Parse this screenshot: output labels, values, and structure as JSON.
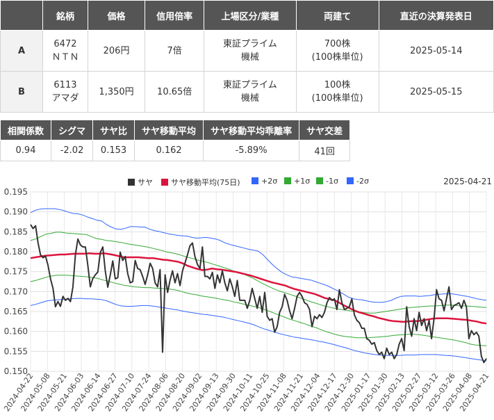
{
  "pair_table": {
    "headers": [
      "",
      "銘柄",
      "価格",
      "信用倍率",
      "上場区分/業種",
      "両建て",
      "直近の決算発表日"
    ],
    "rows": [
      {
        "label": "A",
        "code": "6472",
        "name": "ＮＴＮ",
        "price": "206円",
        "margin_ratio": "7倍",
        "market": "東証プライム",
        "sector": "機械",
        "shares": "700株",
        "unit": "(100株単位)",
        "earnings_date": "2025-05-14"
      },
      {
        "label": "B",
        "code": "6113",
        "name": "アマダ",
        "price": "1,350円",
        "margin_ratio": "10.65倍",
        "market": "東証プライム",
        "sector": "機械",
        "shares": "100株",
        "unit": "(100株単位)",
        "earnings_date": "2025-05-15"
      }
    ]
  },
  "stats_table": {
    "headers": [
      "相関係数",
      "シグマ",
      "サヤ比",
      "サヤ移動平均",
      "サヤ移動平均乖離率",
      "サヤ交差"
    ],
    "values": [
      "0.94",
      "-2.02",
      "0.153",
      "0.162",
      "-5.89%",
      "41回"
    ]
  },
  "chart_date": "2025-04-21",
  "colors": {
    "saya": "#333333",
    "ma": "#dc143c",
    "p2": "#3366ff",
    "p1": "#33aa33",
    "m1": "#33aa33",
    "m2": "#3366ff"
  },
  "chart_data": {
    "type": "line",
    "title": "",
    "xlabel": "",
    "ylabel": "",
    "ylim": [
      0.15,
      0.195
    ],
    "y_ticks": [
      "0.150",
      "0.155",
      "0.160",
      "0.165",
      "0.170",
      "0.175",
      "0.180",
      "0.185",
      "0.190",
      "0.195"
    ],
    "x_tick_labels": [
      "2024-04-22",
      "2024-05-08",
      "2024-05-21",
      "2024-06-03",
      "2024-06-14",
      "2024-06-27",
      "2024-07-10",
      "2024-07-24",
      "2024-08-06",
      "2024-08-20",
      "2024-09-02",
      "2024-09-13",
      "2024-09-30",
      "2024-10-11",
      "2024-10-25",
      "2024-11-08",
      "2024-11-21",
      "2024-12-04",
      "2024-12-17",
      "2024-12-30",
      "2025-01-17",
      "2025-01-30",
      "2025-02-13",
      "2025-02-27",
      "2025-03-12",
      "2025-03-26",
      "2025-04-08",
      "2025-04-21"
    ],
    "grid": true,
    "legend_position": "top",
    "series": [
      {
        "name": "サヤ",
        "color": "#333333",
        "values": [
          0.1868,
          0.1858,
          0.1865,
          0.1822,
          0.1792,
          0.1785,
          0.1789,
          0.1766,
          0.1732,
          0.1708,
          0.1662,
          0.1675,
          0.1663,
          0.1688,
          0.1678,
          0.1683,
          0.1675,
          0.1711,
          0.1792,
          0.1832,
          0.1817,
          0.1812,
          0.1812,
          0.1766,
          0.1712,
          0.1733,
          0.1742,
          0.1749,
          0.1798,
          0.1812,
          0.1752,
          0.1711,
          0.1742,
          0.1777,
          0.1732,
          0.1735,
          0.1799,
          0.1778,
          0.1788,
          0.1745,
          0.1722,
          0.1725,
          0.1778,
          0.1758,
          0.1755,
          0.1738,
          0.1718,
          0.1742,
          0.1771,
          0.1758,
          0.1722,
          0.1712,
          0.1755,
          0.1548,
          0.1742,
          0.1698,
          0.1728,
          0.1752,
          0.1722,
          0.1745,
          0.1715,
          0.1752,
          0.1772,
          0.1792,
          0.1815,
          0.1822,
          0.1788,
          0.1768,
          0.1758,
          0.1812,
          0.1738,
          0.1738,
          0.1732,
          0.1748,
          0.1708,
          0.1742,
          0.1722,
          0.1752,
          0.1722,
          0.1702,
          0.1732,
          0.1712,
          0.1688,
          0.1728,
          0.1678,
          0.1678,
          0.1678,
          0.1658,
          0.1678,
          0.1708,
          0.1683,
          0.1658,
          0.1688,
          0.1648,
          0.1698,
          0.1638,
          0.1628,
          0.1632,
          0.1598,
          0.1612,
          0.1648,
          0.1662,
          0.1693,
          0.1678,
          0.1652,
          0.1632,
          0.1658,
          0.1688,
          0.1698,
          0.1688,
          0.1672,
          0.1668,
          0.1655,
          0.1612,
          0.1638,
          0.1632,
          0.1642,
          0.1635,
          0.1648,
          0.1672,
          0.1685,
          0.1678,
          0.1682,
          0.1655,
          0.1705,
          0.1672,
          0.1655,
          0.1658,
          0.1662,
          0.1682,
          0.1642,
          0.1628,
          0.1622,
          0.1608,
          0.1608,
          0.1582,
          0.1578,
          0.1568,
          0.1572,
          0.1552,
          0.1542,
          0.1548,
          0.1532,
          0.1558,
          0.1542,
          0.1548,
          0.1532,
          0.1542,
          0.1568,
          0.1582,
          0.1552,
          0.1662,
          0.1612,
          0.1588,
          0.1632,
          0.1602,
          0.1648,
          0.1615,
          0.1632,
          0.1602,
          0.1628,
          0.1582,
          0.1632,
          0.1705,
          0.1682,
          0.1678,
          0.1652,
          0.1682,
          0.1712,
          0.1655,
          0.1665,
          0.1668,
          0.1672,
          0.1658,
          0.1678,
          0.1662,
          0.1582,
          0.1602,
          0.1592,
          0.1598,
          0.1588,
          0.1538,
          0.1522,
          0.1532
        ]
      },
      {
        "name": "サヤ移動平均(75日)",
        "color": "#dc143c",
        "values": [
          0.1784,
          0.1786,
          0.1788,
          0.179,
          0.1791,
          0.1792,
          0.1793,
          0.1793,
          0.1794,
          0.1795,
          0.1795,
          0.1795,
          0.1796,
          0.1795,
          0.1795,
          0.1796,
          0.1794,
          0.1792,
          0.1789,
          0.1786,
          0.1786,
          0.1786,
          0.1786,
          0.1785,
          0.1784,
          0.1784,
          0.1782,
          0.178,
          0.1779,
          0.1777,
          0.1775,
          0.1771,
          0.1765,
          0.1761,
          0.1757,
          0.1754,
          0.1755,
          0.1758,
          0.1756,
          0.1755,
          0.1753,
          0.1751,
          0.1749,
          0.1746,
          0.1743,
          0.174,
          0.1736,
          0.1732,
          0.1728,
          0.1724,
          0.1721,
          0.1718,
          0.1715,
          0.171,
          0.1706,
          0.1703,
          0.17,
          0.1697,
          0.1694,
          0.1689,
          0.1684,
          0.1681,
          0.1678,
          0.1672,
          0.1665,
          0.1659,
          0.1653,
          0.1648,
          0.1645,
          0.1641,
          0.1638,
          0.1634,
          0.1631,
          0.1628,
          0.1626,
          0.1625,
          0.1624,
          0.1625,
          0.1626,
          0.1626,
          0.1628,
          0.163,
          0.1632,
          0.1633,
          0.1633,
          0.1633,
          0.1632,
          0.1631,
          0.163,
          0.1629,
          0.1627,
          0.1625,
          0.1622,
          0.162
        ]
      },
      {
        "name": "+2σ",
        "color": "#3366ff",
        "values": [
          0.1898,
          0.1904,
          0.1907,
          0.1908,
          0.1908,
          0.1908,
          0.1906,
          0.1903,
          0.1899,
          0.1896,
          0.1895,
          0.1892,
          0.1887,
          0.1883,
          0.1879,
          0.1877,
          0.1868,
          0.1862,
          0.1857,
          0.1856,
          0.1859,
          0.1863,
          0.1863,
          0.1862,
          0.1862,
          0.1857,
          0.1853,
          0.1851,
          0.1848,
          0.1845,
          0.1843,
          0.1841,
          0.184,
          0.1839,
          0.1836,
          0.1834,
          0.1835,
          0.1836,
          0.1834,
          0.1832,
          0.1828,
          0.1822,
          0.1818,
          0.1815,
          0.1812,
          0.1809,
          0.1806,
          0.1804,
          0.1801,
          0.1792,
          0.1779,
          0.1767,
          0.1757,
          0.1748,
          0.1742,
          0.1737,
          0.1735,
          0.1733,
          0.1731,
          0.1729,
          0.1725,
          0.1721,
          0.1717,
          0.1712,
          0.1706,
          0.17,
          0.1693,
          0.1686,
          0.1682,
          0.168,
          0.1679,
          0.1676,
          0.1674,
          0.1673,
          0.1673,
          0.1675,
          0.1678,
          0.1684,
          0.1688,
          0.1689,
          0.1689,
          0.1689,
          0.1688,
          0.1689,
          0.169,
          0.1692,
          0.1693,
          0.1694,
          0.1695,
          0.1694,
          0.1692,
          0.169,
          0.1688,
          0.1685,
          0.1682,
          0.168,
          0.1678
        ]
      },
      {
        "name": "+1σ",
        "color": "#33aa33",
        "values": [
          0.1828,
          0.1832,
          0.1838,
          0.1844,
          0.1846,
          0.1849,
          0.1849,
          0.1847,
          0.1846,
          0.1845,
          0.1844,
          0.1843,
          0.1838,
          0.1833,
          0.1831,
          0.1828,
          0.1827,
          0.1825,
          0.1823,
          0.182,
          0.1818,
          0.1816,
          0.1814,
          0.1812,
          0.1809,
          0.1806,
          0.1803,
          0.1799,
          0.1797,
          0.1794,
          0.179,
          0.1786,
          0.1783,
          0.1779,
          0.1776,
          0.1773,
          0.1769,
          0.1765,
          0.1761,
          0.1757,
          0.1752,
          0.1749,
          0.1744,
          0.1739,
          0.1733,
          0.1726,
          0.1719,
          0.1713,
          0.1707,
          0.1702,
          0.1698,
          0.1694,
          0.169,
          0.1685,
          0.1681,
          0.1676,
          0.1672,
          0.1668,
          0.1664,
          0.1661,
          0.1658,
          0.1656,
          0.1654,
          0.1652,
          0.165,
          0.1649,
          0.1647,
          0.1646,
          0.1646,
          0.1648,
          0.165,
          0.1652,
          0.1654,
          0.1656,
          0.1658,
          0.166,
          0.1661,
          0.1662,
          0.1663,
          0.1664,
          0.1664,
          0.1665,
          0.1666,
          0.1666,
          0.1665,
          0.1664,
          0.1664,
          0.1663,
          0.1662,
          0.1661,
          0.166
        ]
      },
      {
        "name": "-1σ",
        "color": "#33aa33",
        "values": [
          0.1725,
          0.1728,
          0.1732,
          0.1736,
          0.1739,
          0.1741,
          0.1741,
          0.1741,
          0.174,
          0.1739,
          0.1738,
          0.1737,
          0.1735,
          0.1733,
          0.1729,
          0.1726,
          0.1722,
          0.1719,
          0.1716,
          0.1714,
          0.1712,
          0.1711,
          0.171,
          0.171,
          0.1709,
          0.1708,
          0.1707,
          0.1706,
          0.1704,
          0.1701,
          0.1697,
          0.1694,
          0.1692,
          0.1689,
          0.1687,
          0.1685,
          0.1683,
          0.168,
          0.1678,
          0.1675,
          0.1672,
          0.1669,
          0.1666,
          0.1663,
          0.166,
          0.1656,
          0.1651,
          0.1646,
          0.1641,
          0.1636,
          0.1631,
          0.1627,
          0.1623,
          0.1619,
          0.1614,
          0.161,
          0.1605,
          0.16,
          0.1596,
          0.1592,
          0.1589,
          0.1587,
          0.1586,
          0.1584,
          0.1584,
          0.1584,
          0.1585,
          0.1586,
          0.1587,
          0.1588,
          0.159,
          0.1591,
          0.1592,
          0.1593,
          0.1593,
          0.1592,
          0.159,
          0.1588,
          0.1586,
          0.1584,
          0.1582,
          0.158,
          0.1578,
          0.1575,
          0.1572,
          0.1568,
          0.1566,
          0.1565,
          0.1564
        ]
      },
      {
        "name": "-2σ",
        "color": "#3366ff",
        "values": [
          0.1665,
          0.1668,
          0.1672,
          0.1676,
          0.1678,
          0.1679,
          0.168,
          0.1681,
          0.1682,
          0.1683,
          0.1683,
          0.1682,
          0.1682,
          0.1681,
          0.168,
          0.1677,
          0.1672,
          0.1667,
          0.1664,
          0.1663,
          0.1663,
          0.1664,
          0.1665,
          0.1665,
          0.1664,
          0.1662,
          0.166,
          0.1658,
          0.1656,
          0.1654,
          0.1651,
          0.1649,
          0.1647,
          0.1645,
          0.1643,
          0.1642,
          0.164,
          0.1638,
          0.1636,
          0.1633,
          0.163,
          0.1627,
          0.1624,
          0.1621,
          0.1617,
          0.1612,
          0.1607,
          0.1603,
          0.1599,
          0.1595,
          0.1592,
          0.1589,
          0.1586,
          0.1584,
          0.1582,
          0.158,
          0.1578,
          0.1575,
          0.1573,
          0.157,
          0.1567,
          0.1563,
          0.156,
          0.1556,
          0.1552,
          0.1549,
          0.1546,
          0.1544,
          0.1542,
          0.1541,
          0.154,
          0.154,
          0.154,
          0.154,
          0.1541,
          0.1541,
          0.1541,
          0.1542,
          0.1542,
          0.1542,
          0.1542,
          0.1541,
          0.154,
          0.1539,
          0.1538,
          0.1536,
          0.1534,
          0.1532,
          0.153,
          0.1528,
          0.1526
        ]
      }
    ]
  }
}
